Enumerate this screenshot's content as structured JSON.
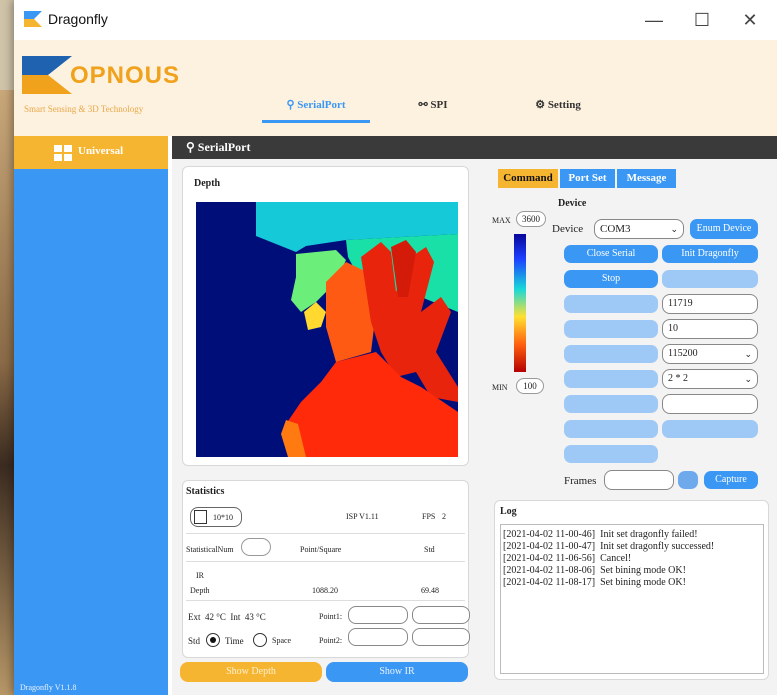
{
  "app": {
    "title": "Dragonfly"
  },
  "window_controls": {
    "minimize": "—",
    "maximize": "☐",
    "close": "✕"
  },
  "logo": {
    "text": "OPNOUS",
    "tagline": "Smart Sensing & 3D Technology"
  },
  "nav": {
    "tabs": [
      {
        "label": "SerialPort",
        "icon": "plug-icon",
        "active": true
      },
      {
        "label": "SPI",
        "icon": "chip-icon",
        "active": false
      },
      {
        "label": "Setting",
        "icon": "gear-icon",
        "active": false
      }
    ]
  },
  "sidebar": {
    "item": "Universal",
    "version": "Dragonfly V1.1.8"
  },
  "section": {
    "title": "SerialPort"
  },
  "depth": {
    "title": "Depth"
  },
  "colorbar": {
    "max_label": "MAX",
    "max_value": "3600",
    "min_label": "MIN",
    "min_value": "100"
  },
  "statistics": {
    "title": "Statistics",
    "region": "10*10",
    "isp": "ISP V1.11",
    "fps_label": "FPS",
    "fps_value": "2",
    "stat_num_label": "StatisticalNum",
    "point_square_label": "Point/Square",
    "std_label": "Std",
    "ir_label": "IR",
    "depth_label": "Depth",
    "depth_value": "1088.20",
    "depth_std": "69.48",
    "ext_label": "Ext",
    "ext_value": "42",
    "int_label": "Int",
    "int_value": "43",
    "unit": "°C",
    "point1_label": "Point1:",
    "point2_label": "Point2:",
    "std_radio": "Std",
    "time_radio": "Time",
    "space_radio": "Space"
  },
  "bottom_buttons": {
    "show_depth": "Show Depth",
    "show_ir": "Show IR"
  },
  "right_tabs": [
    {
      "label": "Command",
      "active": true
    },
    {
      "label": "Port Set",
      "active": false
    },
    {
      "label": "Message",
      "active": false
    }
  ],
  "device": {
    "title": "Device",
    "device_label": "Device",
    "device_value": "COM3",
    "enum_button": "Enum Device",
    "close_serial": "Close Serial",
    "init_button": "Init Dragonfly",
    "stop_button": "Stop",
    "field_1": "11719",
    "field_2": "10",
    "select_1": "115200",
    "select_2": "2 * 2",
    "frames_label": "Frames",
    "capture_button": "Capture"
  },
  "log": {
    "title": "Log",
    "lines": [
      {
        "time": "[2021-04-02 11-00-46]",
        "msg": "Init set dragonfly failed!"
      },
      {
        "time": "[2021-04-02 11-00-47]",
        "msg": "Init set dragonfly successed!"
      },
      {
        "time": "[2021-04-02 11-06-56]",
        "msg": "Cancel!"
      },
      {
        "time": "[2021-04-02 11-08-06]",
        "msg": "Set bining mode OK!"
      },
      {
        "time": "[2021-04-02 11-08-17]",
        "msg": "Set bining mode OK!"
      }
    ]
  },
  "colors": {
    "accent_blue": "#3a97f4",
    "accent_orange": "#f6b530",
    "header_bg": "#fdf1df",
    "depth_bg": "#000e7a"
  }
}
